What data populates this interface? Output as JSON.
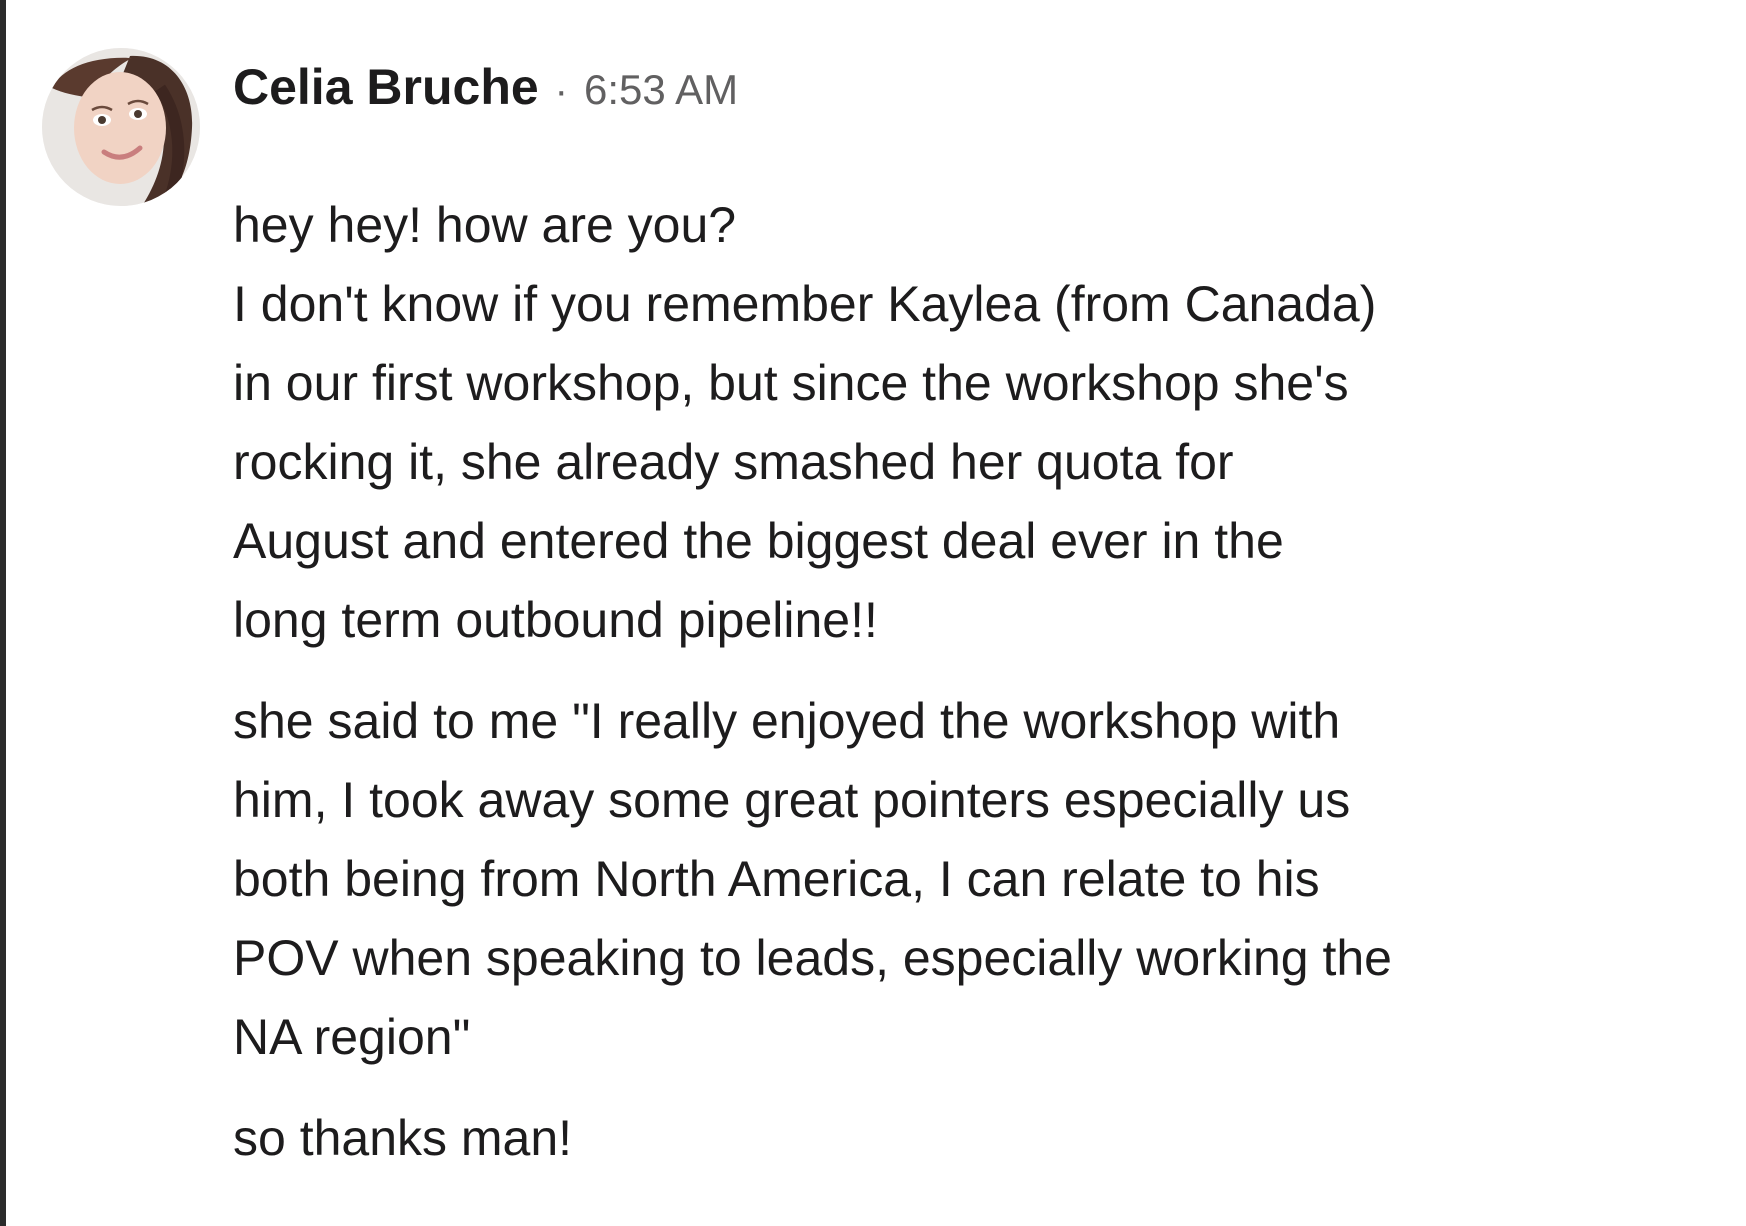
{
  "message": {
    "sender": "Celia Bruche",
    "separator": "·",
    "time": "6:53 AM",
    "paragraphs": [
      {
        "lines": [
          "hey hey! how are you?",
          "I don't know if you remember Kaylea (from Canada)",
          "in our first workshop, but since the workshop she's",
          "rocking it, she already smashed her quota for",
          "August and entered the biggest deal ever in the",
          "long term outbound pipeline!!"
        ]
      },
      {
        "lines": [
          "she said to me \"I really enjoyed the workshop with",
          "him, I took away some great pointers especially us",
          "both being from North America, I can relate to his",
          "POV when speaking to leads, especially working the",
          "NA region\""
        ]
      },
      {
        "lines": [
          "so thanks man!"
        ]
      }
    ],
    "avatar_icon": "user-avatar-photo"
  },
  "colors": {
    "text": "#1d1c1d",
    "muted": "#616061",
    "background": "#ffffff"
  }
}
